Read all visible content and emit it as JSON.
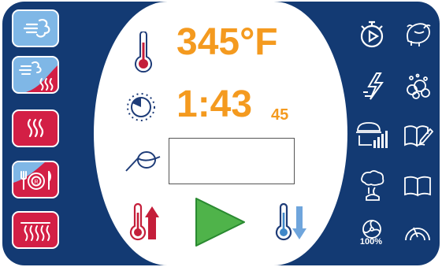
{
  "display": {
    "temperature": "345°F",
    "time_main": "1:43",
    "time_seconds": "45",
    "probe_value": ""
  },
  "right_panel": {
    "fan_percent_label": "100%"
  },
  "colors": {
    "panel_navy": "#133a73",
    "readout_orange": "#f49a1f",
    "heat_red": "#d31f45",
    "steam_blue": "#7fb7e6",
    "start_green": "#4fb34a"
  },
  "icons": {
    "left": [
      "steam-icon",
      "combi-icon",
      "convection-icon",
      "rethermalize-icon",
      "grill-icon"
    ],
    "center": [
      "thermometer-icon",
      "timer-icon",
      "probe-icon",
      "temperature-up-icon",
      "play-icon",
      "temperature-down-icon"
    ],
    "right": [
      "preheat-timer-icon",
      "turkey-icon",
      "quick-power-icon",
      "wash-icon",
      "cooking-chart-icon",
      "recipe-edit-icon",
      "smoke-icon",
      "cookbook-icon",
      "fan-speed-icon",
      "dial-icon"
    ]
  }
}
